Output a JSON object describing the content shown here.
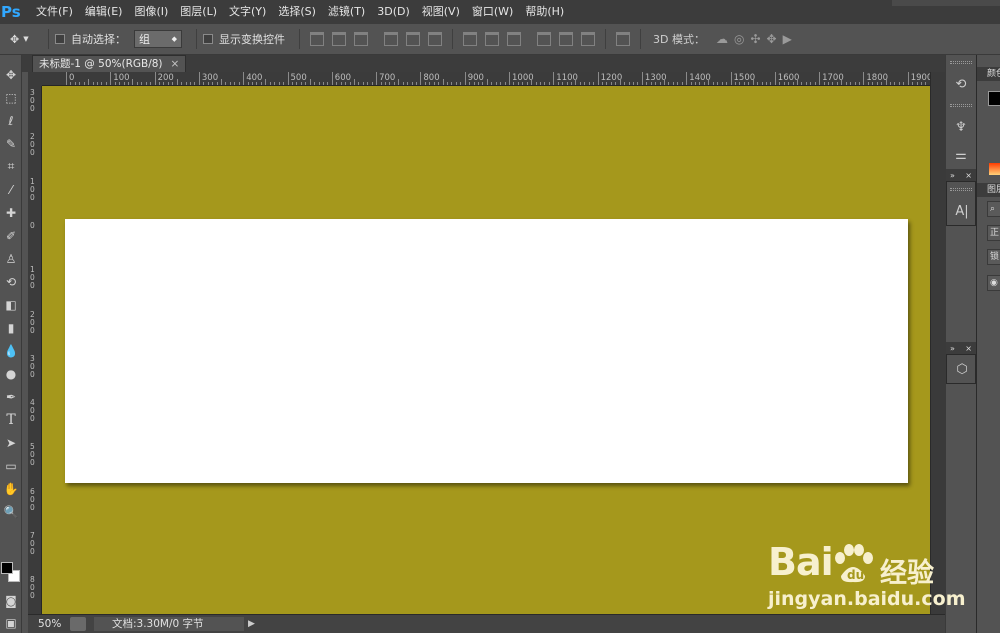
{
  "app": {
    "logo": "Ps"
  },
  "menu": [
    "文件(F)",
    "编辑(E)",
    "图像(I)",
    "图层(L)",
    "文字(Y)",
    "选择(S)",
    "滤镜(T)",
    "3D(D)",
    "视图(V)",
    "窗口(W)",
    "帮助(H)"
  ],
  "options": {
    "auto_select_label": "自动选择：",
    "auto_select_value": "组",
    "show_transform_label": "显示变换控件",
    "mode_label": "3D 模式："
  },
  "document": {
    "tab_title": "未标题-1 @ 50%(RGB/8)",
    "canvas_color": "#a5981c",
    "rect_color": "#ffffff"
  },
  "ruler": {
    "top_labels": [
      "0",
      "100",
      "200",
      "300",
      "400",
      "500",
      "600",
      "700",
      "800",
      "900",
      "1000",
      "1100",
      "1200",
      "1300",
      "1400",
      "1500",
      "1600",
      "1700",
      "1800",
      "1900"
    ],
    "left_labels": [
      "300",
      "200",
      "100",
      "0",
      "100",
      "200",
      "300",
      "400",
      "500",
      "600",
      "700",
      "800"
    ]
  },
  "status": {
    "zoom": "50%",
    "doc_info": "文档:3.30M/0 字节"
  },
  "right_panel": {
    "color_tab": "颜色",
    "layers_tab": "图层",
    "normal_label": "正常",
    "lock_label": "锁定"
  },
  "watermark": {
    "brand": "Bai",
    "brand_cn": "经验",
    "url": "jingyan.baidu.com"
  }
}
